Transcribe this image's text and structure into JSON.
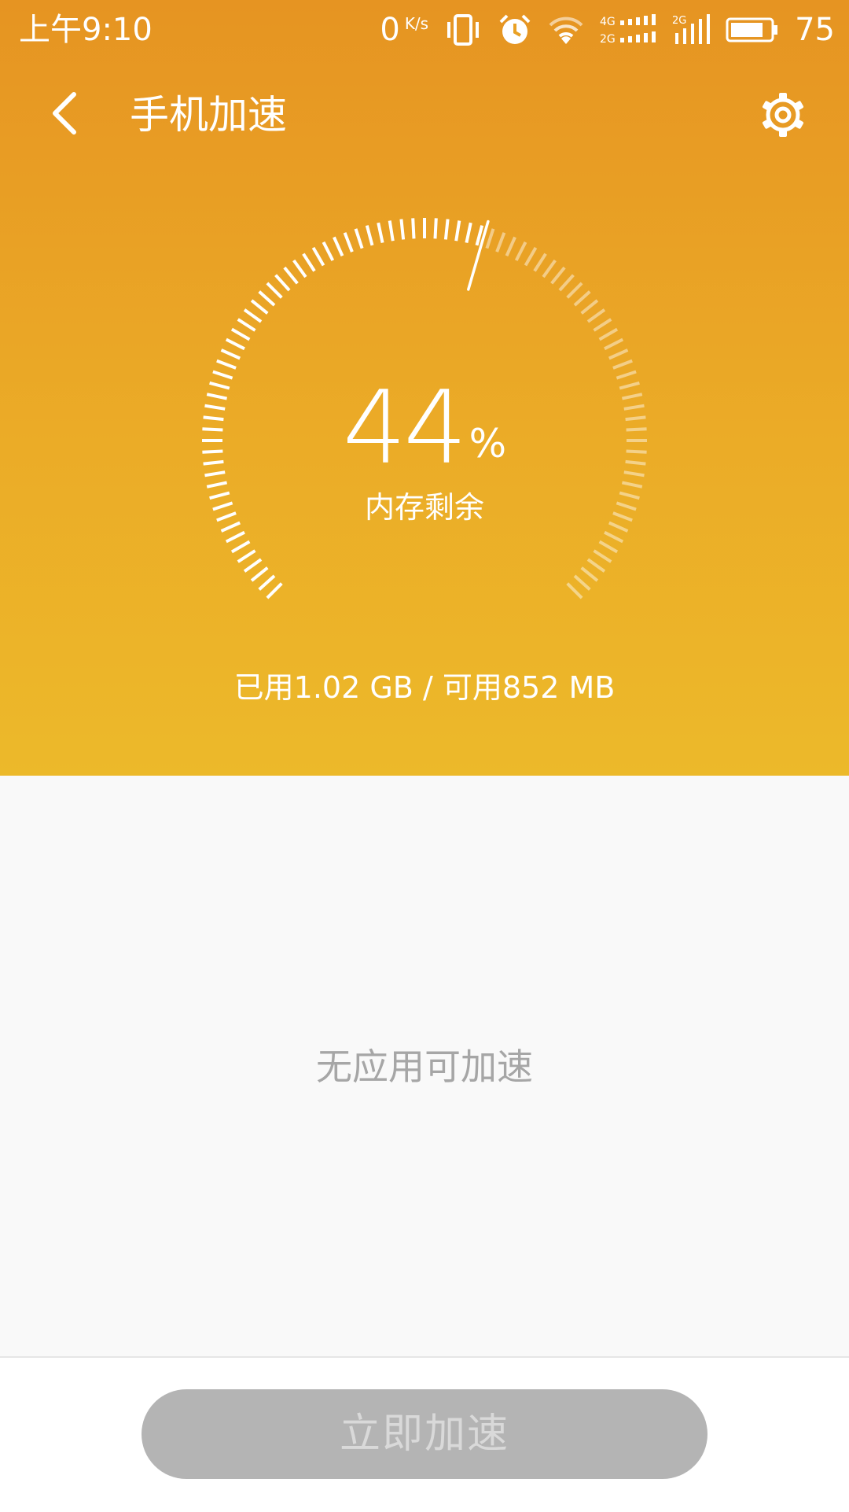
{
  "status_bar": {
    "time": "上午9:10",
    "net_speed": "0",
    "net_speed_unit": "K/s",
    "battery_level": "75",
    "icons": [
      "vibrate-icon",
      "alarm-icon",
      "wifi-icon",
      "signal-4g-icon",
      "signal-2g-icon",
      "battery-icon"
    ]
  },
  "toolbar": {
    "title": "手机加速",
    "back_icon": "chevron-left-icon",
    "settings_icon": "gear-icon"
  },
  "gauge": {
    "value": "44",
    "unit": "%",
    "label": "内存剩余",
    "fraction_used": 0.56
  },
  "memory_summary": "已用1.02 GB / 可用852 MB",
  "empty_state": "无应用可加速",
  "boost_button": {
    "label": "立即加速",
    "disabled": true
  },
  "colors": {
    "hero_top": "#e69422",
    "hero_bottom": "#ecb92a",
    "background": "#f9f9f9",
    "button_disabled": "#b4b4b4",
    "muted_text": "#a6a6a6"
  }
}
